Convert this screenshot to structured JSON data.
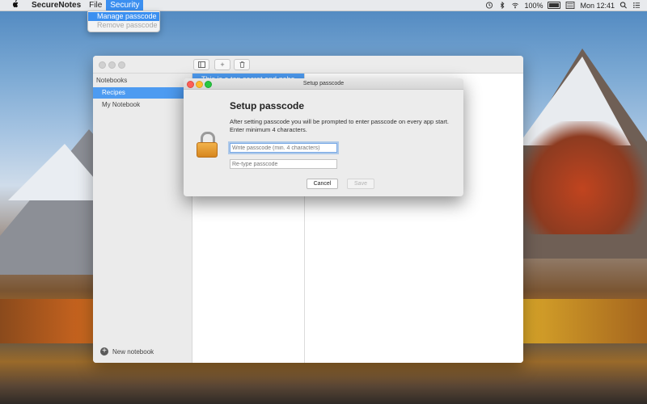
{
  "menubar": {
    "apple_icon": "apple-logo-icon",
    "app_name": "SecureNotes",
    "menus": [
      "File",
      "Security"
    ],
    "active_menu": "Security",
    "status": {
      "battery_percent": "100%",
      "clock": "Mon 12:41"
    }
  },
  "security_menu": {
    "items": [
      {
        "label": "Manage passcode",
        "enabled": true,
        "selected": true
      },
      {
        "label": "Remove passcode",
        "enabled": false,
        "selected": false
      }
    ]
  },
  "window": {
    "toolbar": {
      "sidebar_toggle_icon": "sidebar-icon",
      "add_label": "+",
      "delete_icon": "trash-icon"
    },
    "sidebar": {
      "header": "Notebooks",
      "notebooks": [
        {
          "label": "Recipes",
          "selected": true
        },
        {
          "label": "My Notebook",
          "selected": false
        }
      ],
      "new_notebook_label": "New notebook"
    },
    "note_list": {
      "selected_note_title": "This is a top secret and gobo"
    }
  },
  "passcode_sheet": {
    "window_title": "Setup passcode",
    "heading": "Setup passcode",
    "description": "After setting passcode you will be prompted to enter passcode on every app start. Enter minimum 4 characters.",
    "passcode_placeholder": "Write passcode (min. 4 characters)",
    "retype_placeholder": "Re-type passcode",
    "cancel_label": "Cancel",
    "save_label": "Save",
    "icon": "lock-icon"
  },
  "colors": {
    "selection_blue": "#3b8ff0",
    "sidebar_selection": "#4d9bf1",
    "lock_orange": "#e39a2f"
  }
}
